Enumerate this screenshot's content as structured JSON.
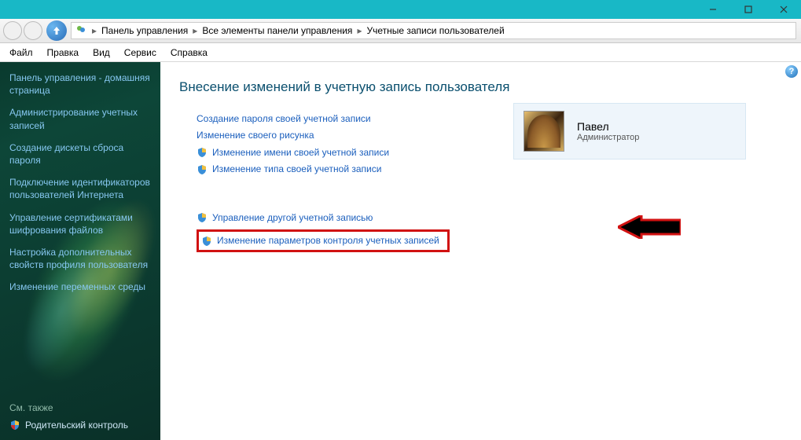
{
  "window": {
    "minimize": "–",
    "maximize": "❐",
    "close": "✕"
  },
  "breadcrumb": {
    "item1": "Панель управления",
    "item2": "Все элементы панели управления",
    "item3": "Учетные записи пользователей"
  },
  "menu": {
    "file": "Файл",
    "edit": "Правка",
    "view": "Вид",
    "service": "Сервис",
    "help": "Справка"
  },
  "sidebar": {
    "items": [
      "Панель управления - домашняя страница",
      "Администрирование учетных записей",
      "Создание дискеты сброса пароля",
      "Подключение идентификаторов пользователей Интернета",
      "Управление сертификатами шифрования файлов",
      "Настройка дополнительных свойств профиля пользователя",
      "Изменение переменных среды"
    ],
    "see_also": "См. также",
    "parental": "Родительский контроль"
  },
  "content": {
    "title": "Внесение изменений в учетную запись пользователя",
    "links1": [
      "Создание пароля своей учетной записи",
      "Изменение своего рисунка",
      "Изменение имени своей учетной записи",
      "Изменение типа своей учетной записи"
    ],
    "links2": [
      "Управление другой учетной записью",
      "Изменение параметров контроля учетных записей"
    ],
    "links1_shield": [
      false,
      false,
      true,
      true
    ],
    "links2_shield": [
      true,
      true
    ]
  },
  "user": {
    "name": "Павел",
    "role": "Администратор"
  },
  "help": "?"
}
